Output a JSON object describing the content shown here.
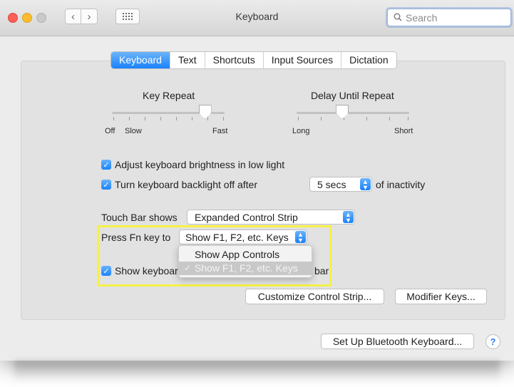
{
  "window": {
    "title": "Keyboard"
  },
  "search": {
    "placeholder": "Search"
  },
  "tabs": [
    "Keyboard",
    "Text",
    "Shortcuts",
    "Input Sources",
    "Dictation"
  ],
  "active_tab": "Keyboard",
  "key_repeat": {
    "title": "Key Repeat",
    "left_label": "Off",
    "left_label2": "Slow",
    "right_label": "Fast",
    "value_fraction": 0.82
  },
  "delay_until_repeat": {
    "title": "Delay Until Repeat",
    "left_label": "Long",
    "right_label": "Short",
    "value_fraction": 0.4
  },
  "checks": {
    "brightness": {
      "label": "Adjust keyboard brightness in low light",
      "checked": true
    },
    "backlight": {
      "label": "Turn keyboard backlight off after",
      "checked": true,
      "popup_value": "5 secs",
      "suffix": "of inactivity"
    },
    "show_keyboard": {
      "label_start": "Show keyboar",
      "label_end": "bar",
      "checked": true
    }
  },
  "touch_bar": {
    "label": "Touch Bar shows",
    "value": "Expanded Control Strip"
  },
  "fn_key": {
    "label": "Press Fn key to",
    "value": "Show F1, F2, etc. Keys"
  },
  "fn_menu": {
    "items": [
      "Show App Controls",
      "Show F1, F2, etc. Keys"
    ],
    "selected": "Show F1, F2, etc. Keys"
  },
  "buttons": {
    "customize": "Customize Control Strip...",
    "modifier": "Modifier Keys...",
    "bluetooth": "Set Up Bluetooth Keyboard...",
    "help": "?"
  },
  "colors": {
    "accent": "#1a82fb",
    "highlight": "#f6f048"
  }
}
